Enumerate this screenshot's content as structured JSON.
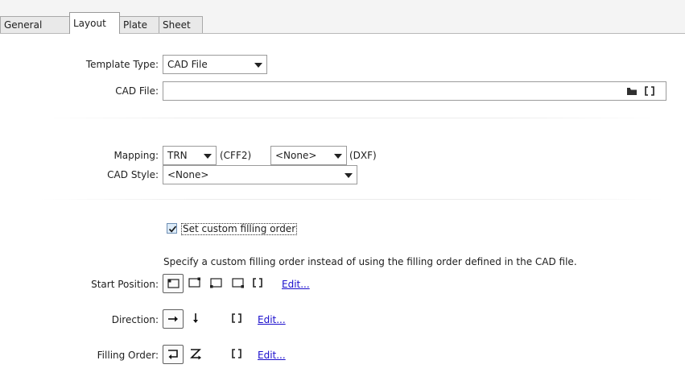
{
  "tabs": [
    "General",
    "Layout",
    "Plate",
    "Sheet"
  ],
  "template": {
    "type_label": "Template Type:",
    "type_value": "CAD File",
    "cad_file_label": "CAD File:",
    "cad_file_value": ""
  },
  "mapping": {
    "label": "Mapping:",
    "cff2_value": "TRN",
    "cff2_suffix": "(CFF2)",
    "dxf_value": "<None>",
    "dxf_suffix": "(DXF)"
  },
  "cad_style": {
    "label": "CAD Style:",
    "value": "<None>"
  },
  "custom_order": {
    "checkbox_label": "Set custom filling order",
    "checked": true,
    "description": "Specify a custom filling order instead of using the filling order defined in the CAD file."
  },
  "start_position": {
    "label": "Start Position:",
    "options": [
      "top-left-icon",
      "top-right-icon",
      "bottom-left-icon",
      "bottom-right-icon",
      "custom-icon"
    ],
    "edit": "Edit..."
  },
  "direction": {
    "label": "Direction:",
    "options": [
      "arrow-right-icon",
      "arrow-down-icon",
      "custom-icon"
    ],
    "edit": "Edit..."
  },
  "filling_order": {
    "label": "Filling Order:",
    "options": [
      "return-icon",
      "zigzag-icon",
      "custom-icon"
    ],
    "edit": "Edit..."
  },
  "icons": {
    "folder": "folder-icon",
    "clear": "brackets-icon"
  },
  "colors": {
    "link": "#1a0dcc",
    "checkbox": "#dcebf8",
    "tab_active": "#ffffff"
  }
}
